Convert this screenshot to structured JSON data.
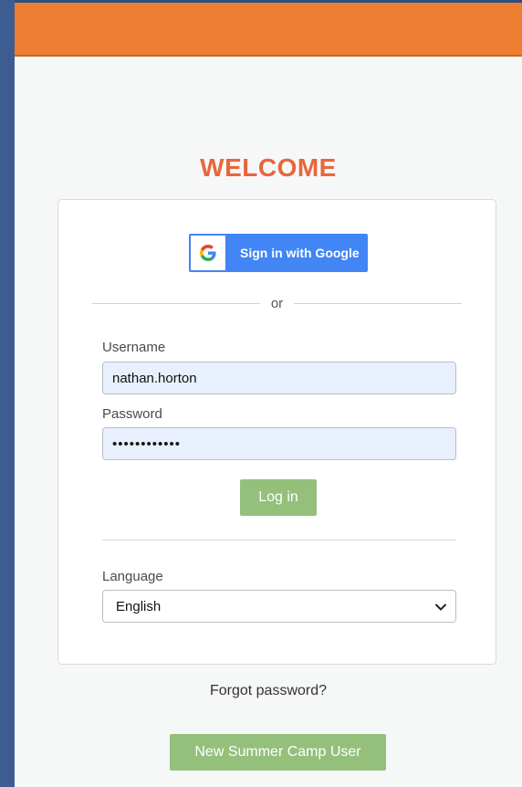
{
  "header": {
    "color": "#ed7d31"
  },
  "welcome": {
    "title": "WELCOME"
  },
  "google": {
    "label": "Sign in with Google",
    "icon": "google-g-icon"
  },
  "divider": {
    "or_text": "or"
  },
  "form": {
    "username_label": "Username",
    "username_value": "nathan.horton",
    "password_label": "Password",
    "password_value": "••••••••••••",
    "login_label": "Log in"
  },
  "language": {
    "label": "Language",
    "selected": "English",
    "icon": "chevron-down-icon"
  },
  "links": {
    "forgot_password": "Forgot password?",
    "new_user": "New Summer Camp User"
  },
  "colors": {
    "accent_orange": "#ed7d31",
    "welcome_text": "#e8663d",
    "google_blue": "#4285f4",
    "button_green": "#94c07c",
    "sidebar_blue": "#3f5f94"
  }
}
